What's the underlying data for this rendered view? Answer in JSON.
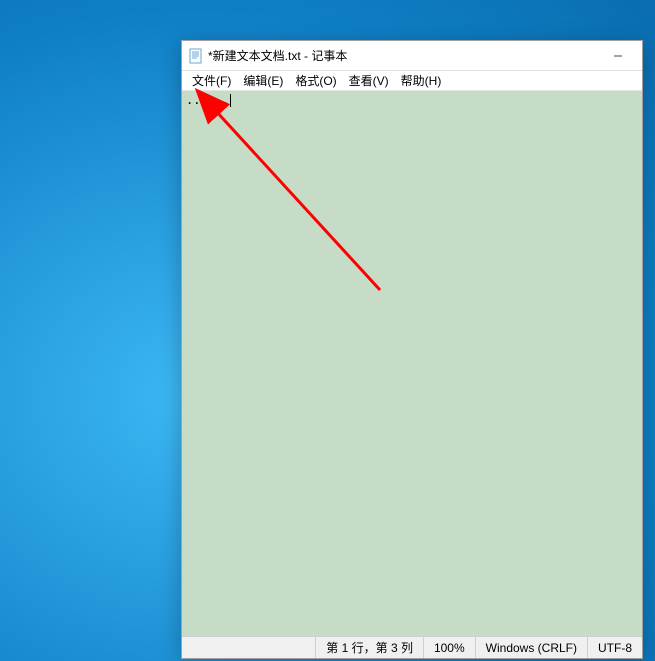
{
  "window": {
    "title": "*新建文本文档.txt - 记事本"
  },
  "menu": {
    "file": "文件(F)",
    "edit": "编辑(E)",
    "format": "格式(O)",
    "view": "查看(V)",
    "help": "帮助(H)"
  },
  "editor": {
    "content": "......"
  },
  "statusbar": {
    "position": "第 1 行，第 3 列",
    "zoom": "100%",
    "line_ending": "Windows (CRLF)",
    "encoding": "UTF-8"
  }
}
